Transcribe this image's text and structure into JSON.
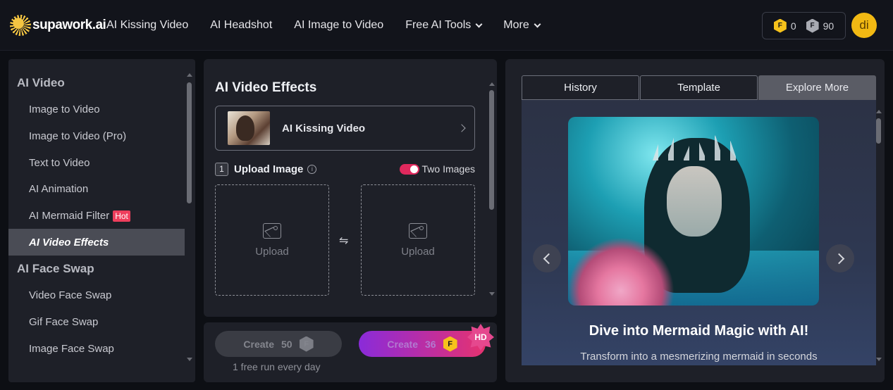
{
  "brand": {
    "logo_text": "supawork.ai"
  },
  "nav": {
    "items": [
      {
        "label": "AI Kissing Video",
        "dropdown": false
      },
      {
        "label": "AI Headshot",
        "dropdown": false
      },
      {
        "label": "AI Image to Video",
        "dropdown": false
      },
      {
        "label": "Free AI Tools",
        "dropdown": true
      },
      {
        "label": "More",
        "dropdown": true
      }
    ]
  },
  "credits": {
    "gold": "0",
    "grey": "90"
  },
  "user": {
    "initials": "di"
  },
  "sidebar": {
    "groups": [
      {
        "title": "AI Video",
        "items": [
          {
            "label": "Image to Video"
          },
          {
            "label": "Image to Video (Pro)"
          },
          {
            "label": "Text to Video"
          },
          {
            "label": "AI Animation"
          },
          {
            "label": "AI Mermaid Filter",
            "badge": "Hot"
          },
          {
            "label": "AI Video Effects",
            "active": true
          }
        ]
      },
      {
        "title": "AI Face Swap",
        "items": [
          {
            "label": "Video Face Swap"
          },
          {
            "label": "Gif Face Swap"
          },
          {
            "label": "Image Face Swap"
          }
        ]
      }
    ]
  },
  "editor": {
    "title": "AI Video Effects",
    "effect_label": "AI Kissing Video",
    "step_number": "1",
    "upload_title": "Upload Image",
    "info_glyph": "i",
    "toggle_label": "Two Images",
    "toggle_on": true,
    "upload_label_1": "Upload",
    "upload_label_2": "Upload",
    "swap_glyph": "⇋"
  },
  "create": {
    "button_a": {
      "label": "Create",
      "cost": "50"
    },
    "button_b": {
      "label": "Create",
      "cost": "36"
    },
    "hd_badge": "HD",
    "note": "1 free run every day"
  },
  "preview": {
    "tabs": [
      {
        "label": "History",
        "active": false
      },
      {
        "label": "Template",
        "active": false
      },
      {
        "label": "Explore More",
        "active": true
      }
    ],
    "headline": "Dive into Mermaid Magic with AI!",
    "subline": "Transform into a mesmerizing mermaid in seconds"
  },
  "colors": {
    "accent_pink": "#e0295d",
    "gold": "#f6c21b",
    "hot_badge": "#ee3e5c"
  }
}
